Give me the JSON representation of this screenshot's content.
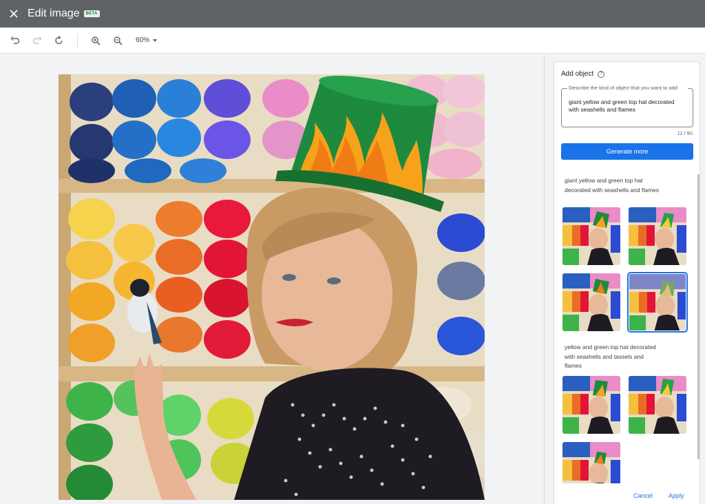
{
  "header": {
    "title": "Edit image",
    "badge": "BETA"
  },
  "toolbar": {
    "zoom_label": "60%"
  },
  "panel": {
    "heading": "Add object",
    "prompt_label": "Describe the kind of object that you want to add",
    "prompt_value": "giant yellow and green top hat decorated with seashells and flames",
    "counter": "11 / 90",
    "generate_label": "Generate more",
    "results": [
      {
        "caption": "giant yellow and green top hat decorated with seashells and flames",
        "thumbnail_count": 4,
        "selected_index": 3
      },
      {
        "caption": "yellow and green top hat decorated with seashells and tassels and flames",
        "thumbnail_count": 3
      }
    ],
    "cancel_label": "Cancel",
    "apply_label": "Apply"
  },
  "colors": {
    "titlebar": "#5f6368",
    "accent": "#1a73e8",
    "hat_green": "#1e8a3e",
    "flame": "#f6a21a"
  }
}
